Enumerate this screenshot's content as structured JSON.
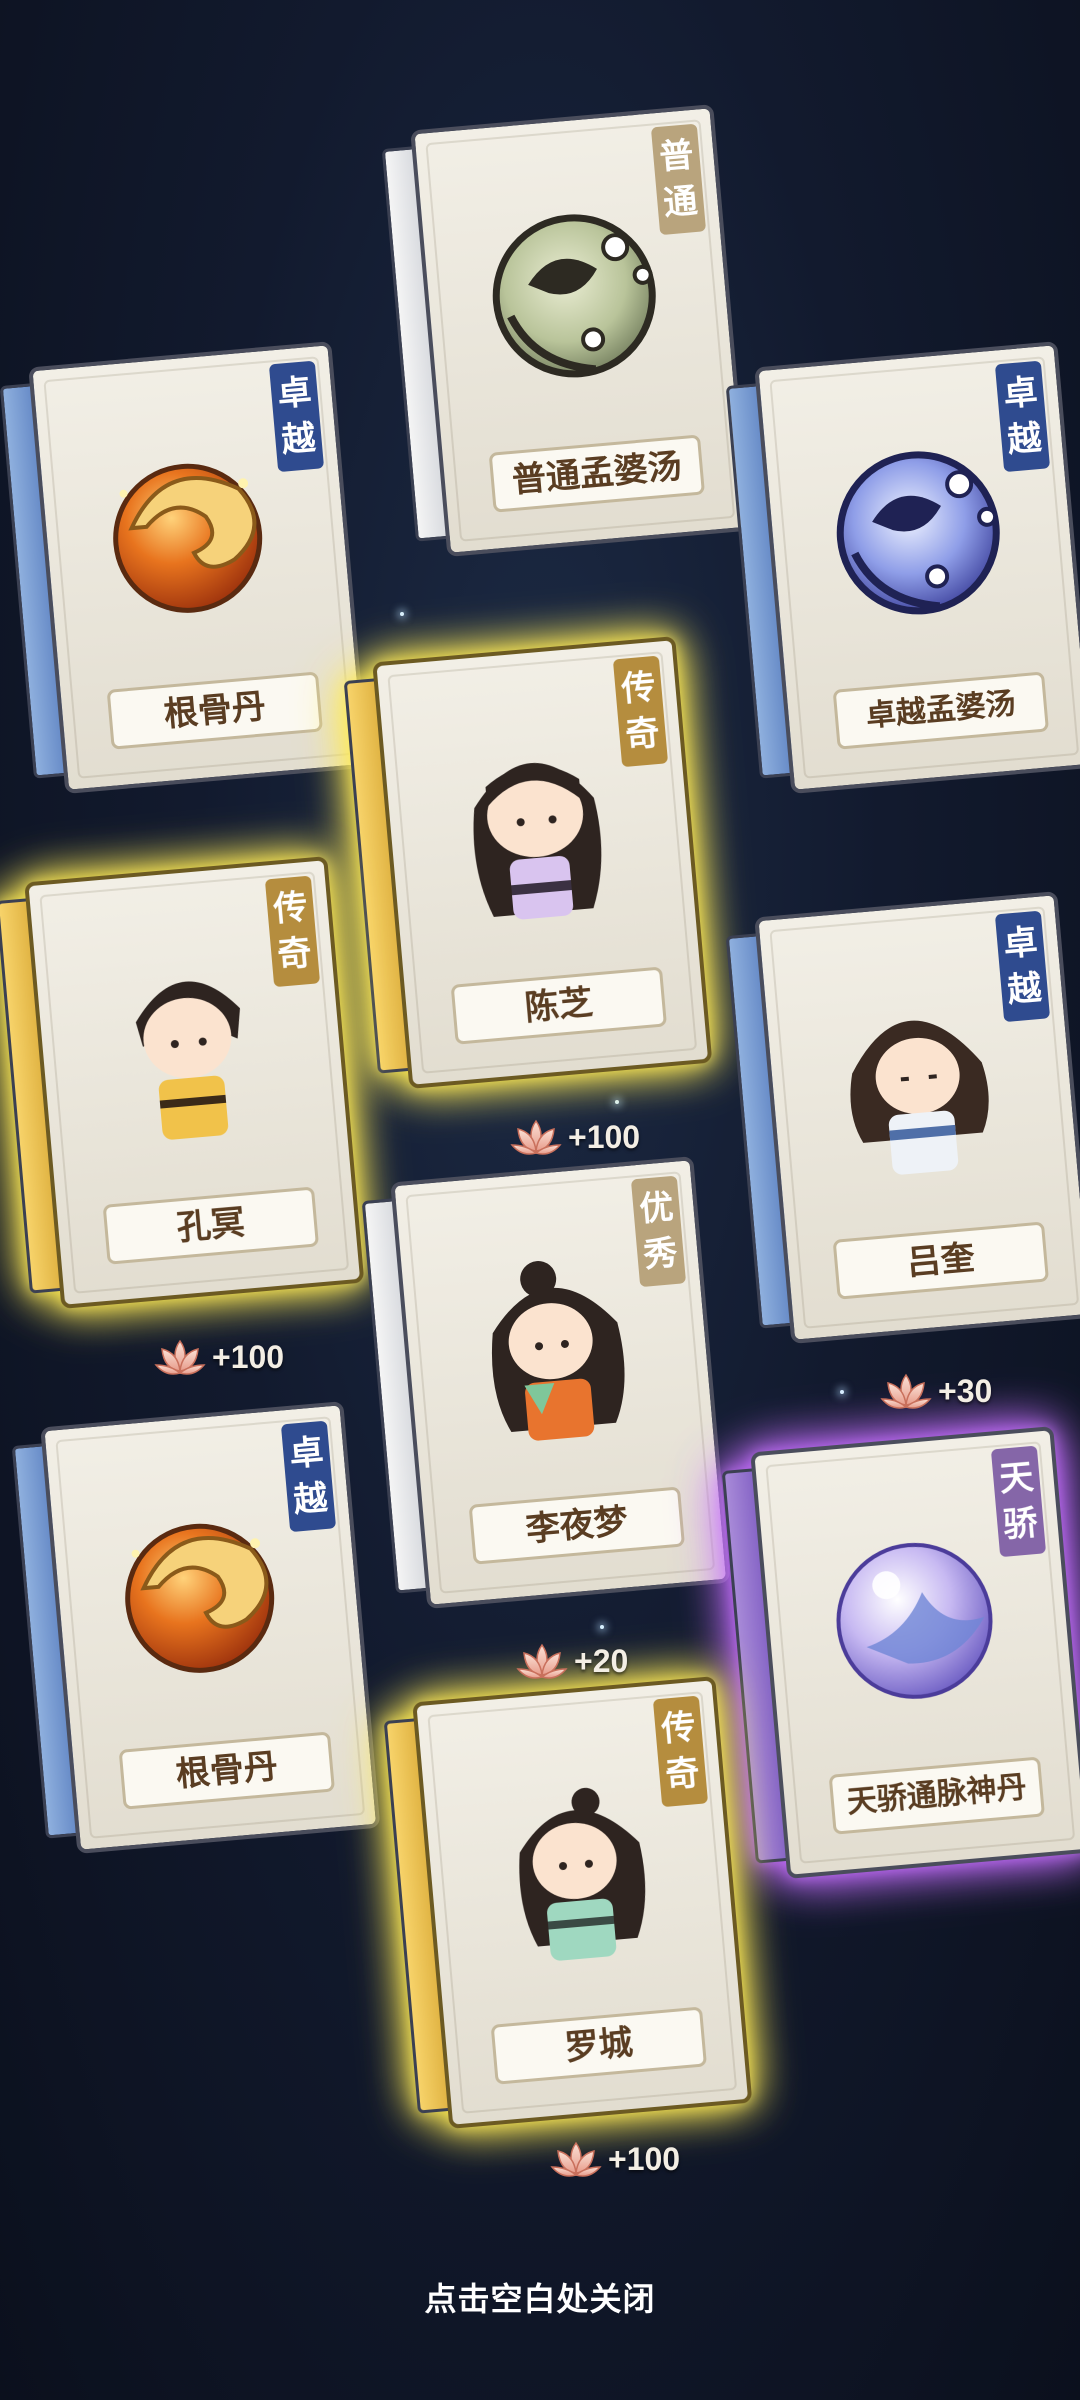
{
  "cards": [
    {
      "tag": "普通",
      "name": "普通孟婆汤",
      "rarity": "white",
      "art": "soup-icon"
    },
    {
      "tag": "卓越",
      "name": "根骨丹",
      "rarity": "blue",
      "art": "pill-icon"
    },
    {
      "tag": "卓越",
      "name": "卓越孟婆汤",
      "rarity": "blue",
      "art": "soup-icon"
    },
    {
      "tag": "传奇",
      "name": "陈芝",
      "rarity": "gold",
      "art": "character-avatar"
    },
    {
      "tag": "传奇",
      "name": "孔冥",
      "rarity": "gold",
      "art": "character-avatar"
    },
    {
      "tag": "卓越",
      "name": "吕奎",
      "rarity": "blue",
      "art": "character-avatar"
    },
    {
      "tag": "优秀",
      "name": "李夜梦",
      "rarity": "white",
      "art": "character-avatar"
    },
    {
      "tag": "卓越",
      "name": "根骨丹",
      "rarity": "blue",
      "art": "pill-icon"
    },
    {
      "tag": "天骄",
      "name": "天骄通脉神丹",
      "rarity": "purple",
      "art": "orb-icon"
    },
    {
      "tag": "传奇",
      "name": "罗城",
      "rarity": "gold",
      "art": "character-avatar"
    }
  ],
  "rewards": [
    {
      "amount": "+100",
      "icon": "lotus-icon"
    },
    {
      "amount": "+100",
      "icon": "lotus-icon"
    },
    {
      "amount": "+30",
      "icon": "lotus-icon"
    },
    {
      "amount": "+20",
      "icon": "lotus-icon"
    },
    {
      "amount": "+100",
      "icon": "lotus-icon"
    }
  ],
  "footer": {
    "close_hint": "点击空白处关闭"
  },
  "colors": {
    "legendary_glow": "#ffe83c",
    "heavenly_glow": "#be5aff",
    "excellent_tag": "#2f4b8f",
    "legendary_tag": "#b58d3e",
    "heavenly_tag": "#8566a8",
    "name_text": "#5a3d22"
  }
}
